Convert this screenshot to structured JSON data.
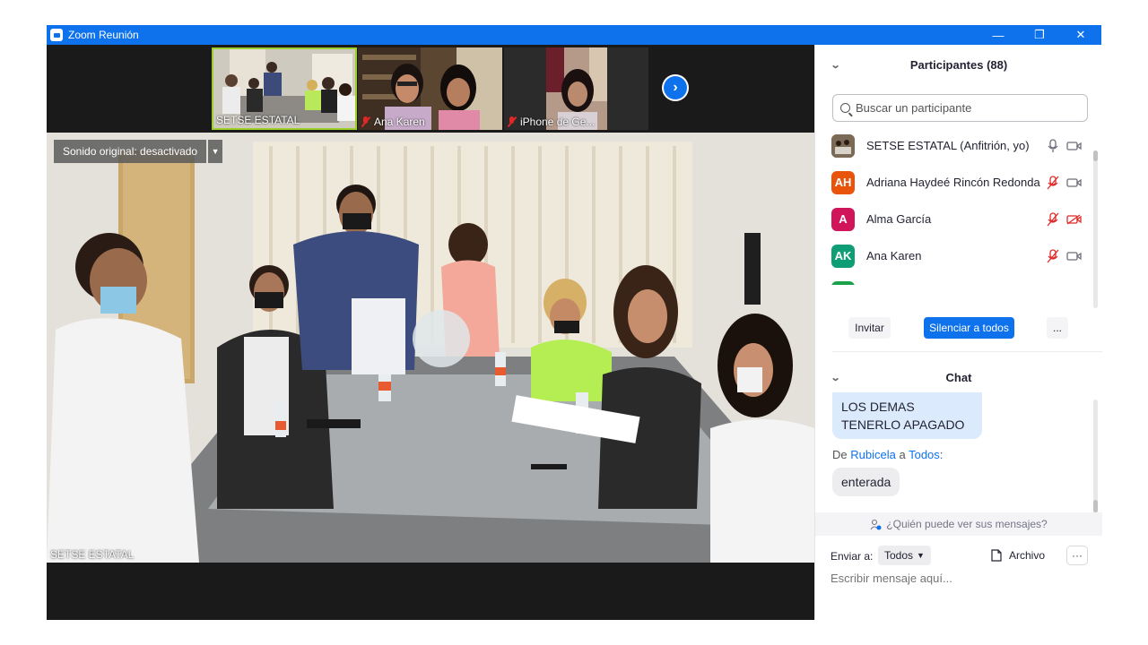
{
  "window": {
    "title": "Zoom Reunión",
    "controls": {
      "minimize": "—",
      "restore": "❐",
      "close": "✕"
    }
  },
  "thumbnails": [
    {
      "label": "SETSE ESTATAL",
      "muted": false,
      "active": true
    },
    {
      "label": "Ana Karen",
      "muted": true,
      "active": false
    },
    {
      "label": "iPhone de Ge...",
      "muted": true,
      "active": false
    }
  ],
  "main_video": {
    "sound_button": "Sonido original: desactivado",
    "speaker_name": "SETSE ESTATAL"
  },
  "participants_panel": {
    "title": "Participantes (88)",
    "search_placeholder": "Buscar un participante",
    "participants": [
      {
        "name": "SETSE ESTATAL (Anfitrión, yo)",
        "initials": "",
        "avatar_color": "#6b5a45",
        "mic_muted": false,
        "cam_off": false
      },
      {
        "name": "Adriana Haydeé Rincón Redonda",
        "initials": "AH",
        "avatar_color": "#e8540c",
        "mic_muted": true,
        "cam_off": false
      },
      {
        "name": "Alma García",
        "initials": "A",
        "avatar_color": "#d0155a",
        "mic_muted": true,
        "cam_off": true
      },
      {
        "name": "Ana Karen",
        "initials": "AK",
        "avatar_color": "#0f9d75",
        "mic_muted": true,
        "cam_off": false
      }
    ],
    "invite_button": "Invitar",
    "mute_all_button": "Silenciar a todos",
    "more_button": "..."
  },
  "chat_panel": {
    "title": "Chat",
    "messages": [
      {
        "text": "LOS DEMAS TENERLO APAGADO"
      },
      {
        "from_prefix": "De",
        "sender": "Rubicela",
        "to_word": "a",
        "recipient": "Todos",
        "suffix": ":",
        "text": "enterada"
      }
    ],
    "who_can_see": "¿Quién puede ver sus mensajes?",
    "send_to_label": "Enviar a:",
    "send_to_value": "Todos",
    "file_button": "Archivo",
    "more_button": "···",
    "input_placeholder": "Escribir mensaje aquí..."
  },
  "colors": {
    "accent": "#0e72ed",
    "muted_red": "#e02828"
  }
}
